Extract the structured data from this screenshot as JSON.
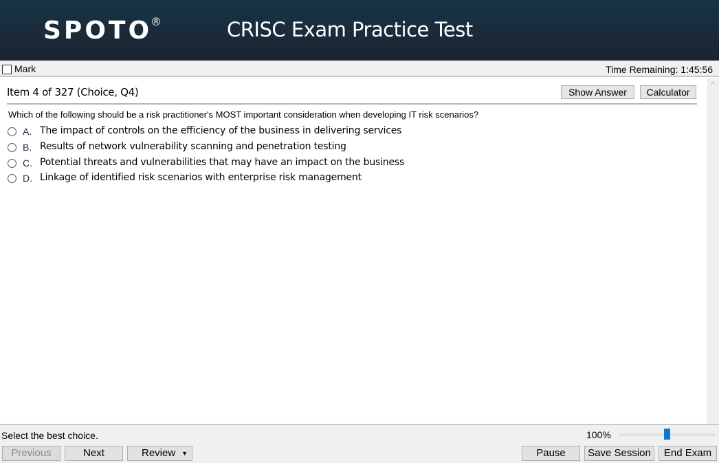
{
  "header": {
    "logo": "SPOTO",
    "logo_mark": "®",
    "title": "CRISC Exam Practice Test"
  },
  "markbar": {
    "mark_label": "Mark",
    "mark_checked": false,
    "time_remaining": "Time Remaining: 1:45:56"
  },
  "item": {
    "title": "Item 4 of 327 (Choice, Q4)",
    "show_answer_label": "Show Answer",
    "calculator_label": "Calculator",
    "question": "Which of the following should be a risk practitioner's MOST important consideration when developing IT risk scenarios?",
    "options": [
      {
        "letter": "A.",
        "text": "The impact of controls on the efficiency of the business in delivering services",
        "selected": false
      },
      {
        "letter": "B.",
        "text": "Results of network vulnerability scanning and penetration testing",
        "selected": false
      },
      {
        "letter": "C.",
        "text": "Potential threats and vulnerabilities that may have an impact on the business",
        "selected": false
      },
      {
        "letter": "D.",
        "text": "Linkage of identified risk scenarios with enterprise risk management",
        "selected": false
      }
    ]
  },
  "scrollbar": {
    "up_icon": "^"
  },
  "status": {
    "instruction": "Select the best choice.",
    "zoom_label": "100%",
    "zoom_value": 0.5
  },
  "nav": {
    "previous_label": "Previous",
    "next_label": "Next",
    "review_label": "Review",
    "review_caret": "▼",
    "pause_label": "Pause",
    "save_session_label": "Save Session",
    "end_exam_label": "End Exam"
  },
  "colors": {
    "header_top": "#173447",
    "header_bottom": "#1c2230",
    "option_letter": "#1d2a4a",
    "zoom_thumb": "#0a78d7"
  }
}
